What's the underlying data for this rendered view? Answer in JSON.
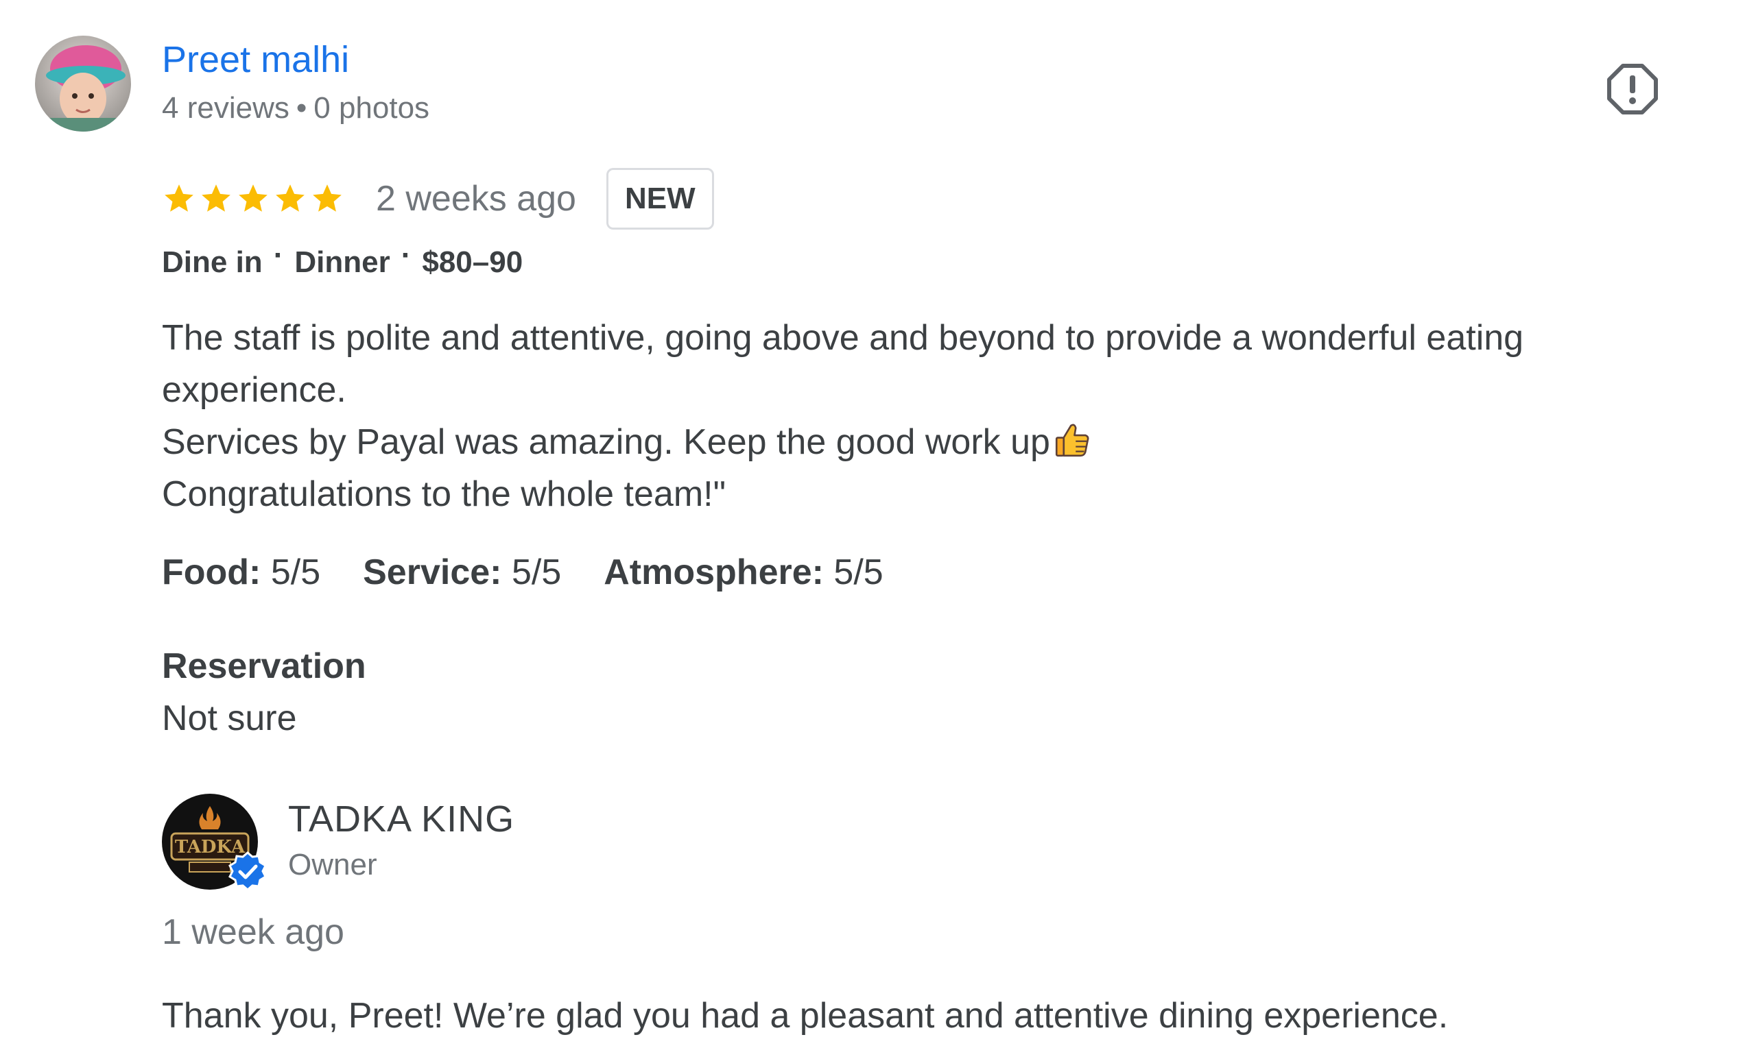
{
  "reviewer": {
    "name": "Preet malhi",
    "reviews": "4 reviews",
    "separator": "•",
    "photos": "0 photos",
    "avatar_icon": "user-photo-avatar"
  },
  "report_icon": "report-flag-icon",
  "rating": {
    "stars": 5,
    "max_stars": 5,
    "star_color": "#fbbc04",
    "time_ago": "2 weeks ago",
    "badge": "NEW"
  },
  "tags": {
    "items": [
      "Dine in",
      "Dinner",
      "$80–90"
    ],
    "separator": "·"
  },
  "review_text": {
    "line1": "The staff is polite and attentive, going above and beyond to provide a wonderful eating experience.",
    "line2": "Services by Payal was amazing. Keep the good work up",
    "line2_emoji": "thumbs-up-icon",
    "line3": "Congratulations to the whole team!\""
  },
  "subratings": [
    {
      "label": "Food:",
      "value": "5/5"
    },
    {
      "label": "Service:",
      "value": "5/5"
    },
    {
      "label": "Atmosphere:",
      "value": "5/5"
    }
  ],
  "reservation": {
    "label": "Reservation",
    "value": "Not sure"
  },
  "owner": {
    "name": "TADKA KING",
    "role": "Owner",
    "logo_text": "TADKA",
    "verified_color": "#1a73e8",
    "reply_time": "1 week ago",
    "reply_text": "Thank you, Preet! We’re glad you had a pleasant and attentive dining experience."
  },
  "colors": {
    "link": "#1a73e8",
    "text": "#3c4043",
    "secondary": "#70757a",
    "star": "#fbbc04"
  }
}
